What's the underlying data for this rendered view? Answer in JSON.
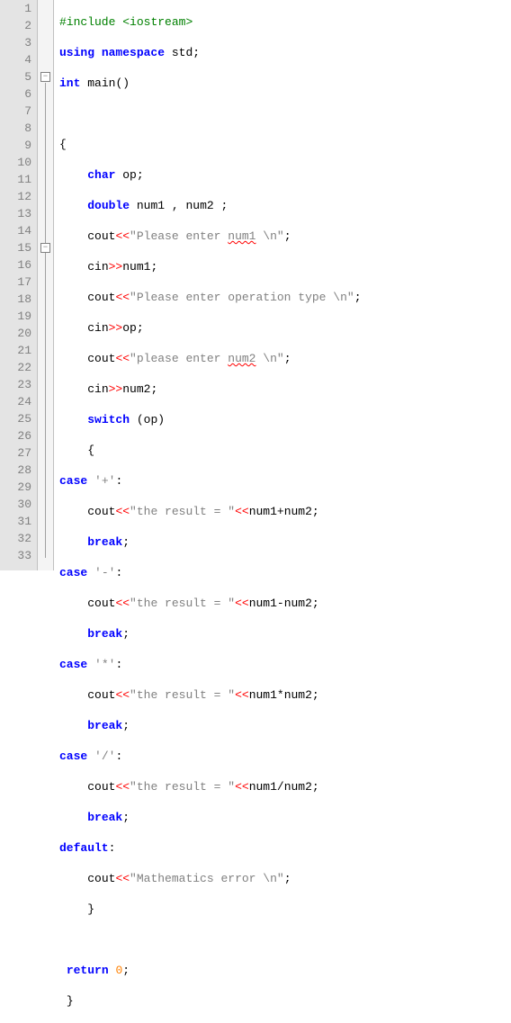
{
  "gutter": {
    "1": "1",
    "2": "2",
    "3": "3",
    "4": "4",
    "5": "5",
    "6": "6",
    "7": "7",
    "8": "8",
    "9": "9",
    "10": "10",
    "11": "11",
    "12": "12",
    "13": "13",
    "14": "14",
    "15": "15",
    "16": "16",
    "17": "17",
    "18": "18",
    "19": "19",
    "20": "20",
    "21": "21",
    "22": "22",
    "23": "23",
    "24": "24",
    "25": "25",
    "26": "26",
    "27": "27",
    "28": "28",
    "29": "29",
    "30": "30",
    "31": "31",
    "32": "32",
    "33": "33"
  },
  "tok": {
    "include": "#include",
    "iostream": "<iostream>",
    "using": "using",
    "namespace": "namespace",
    "std": "std",
    "int": "int",
    "main": "main",
    "parens": "()",
    "lbrace": "{",
    "rbrace": "}",
    "char": "char",
    "double": "double",
    "op_var": "op",
    "num1": "num1",
    "num2": "num2",
    "comma": ",",
    "space": " ",
    "cout": "cout",
    "cin": "cin",
    "ltlt": "<<",
    "gtgt": ">>",
    "s_enter_num1_a": "\"Please enter ",
    "s_enter_num1_b": "num1",
    "s_enter_num1_c": " \\n\"",
    "s_enter_op": "\"Please enter operation type \\n\"",
    "s_enter_num2_a": "\"please enter ",
    "s_enter_num2_b": "num2",
    "s_enter_num2_c": " \\n\"",
    "switch": "switch",
    "case": "case",
    "break": "break",
    "default": "default",
    "plus": "'+'",
    "minus": "'-'",
    "star": "'*'",
    "slash": "'/'",
    "s_result": "\"the result = \"",
    "e_add": "num1+num2",
    "e_sub": "num1-num2",
    "e_mul": "num1*num2",
    "e_div": "num1/num2",
    "s_matherr": "\"Mathematics error \\n\"",
    "return": "return",
    "zero": "0",
    "semi": ";",
    "colon": ":"
  }
}
